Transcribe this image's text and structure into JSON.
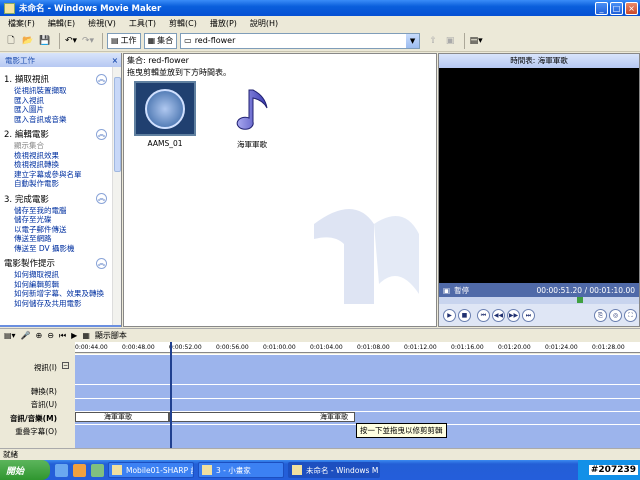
{
  "window": {
    "title": "未命名 - Windows Movie Maker"
  },
  "menu": [
    "檔案(F)",
    "編輯(E)",
    "檢視(V)",
    "工具(T)",
    "剪輯(C)",
    "播放(P)",
    "說明(H)"
  ],
  "toolbar": {
    "tasks_label": "工作",
    "collections_label": "集合",
    "collection_value": "red-flower"
  },
  "tasks_pane": {
    "header": "電影工作",
    "sections": [
      {
        "number": "1.",
        "title": "擷取視訊",
        "links": [
          "從視訊裝置擷取",
          "匯入視訊",
          "匯入圖片",
          "匯入音訊或音樂"
        ],
        "disabled": []
      },
      {
        "number": "2.",
        "title": "編輯電影",
        "links": [
          "顯示集合",
          "檢視視訊效果",
          "檢視視訊轉換",
          "建立字幕或參與名單",
          "自動製作電影"
        ],
        "disabled": [
          0
        ]
      },
      {
        "number": "3.",
        "title": "完成電影",
        "links": [
          "儲存至我的電腦",
          "儲存至光碟",
          "以電子郵件傳送",
          "傳送至網路",
          "傳送至 DV 攝影機"
        ],
        "disabled": []
      },
      {
        "number": "",
        "title": "電影製作提示",
        "links": [
          "如何擷取視訊",
          "如何編輯剪輯",
          "如何新增字幕、效果及轉換",
          "如何儲存及共用電影"
        ],
        "disabled": []
      }
    ]
  },
  "collection": {
    "title": "集合: red-flower",
    "subtitle": "拖曳剪輯並放到下方時間表。",
    "clips": [
      {
        "label": "AAMS_01",
        "icon": "video-thumbnail-icon"
      },
      {
        "label": "海軍軍歌",
        "icon": "music-note-icon"
      }
    ]
  },
  "preview": {
    "header": "時間表: 海軍軍歌",
    "status": "暫停",
    "time": "00:00:51.20 / 00:01:10.00",
    "seek_fraction": 0.71
  },
  "timeline": {
    "toggle_label": "顯示腳本",
    "ruler": [
      "0:00:44.00",
      "0:00:48.00",
      "0:00:52.00",
      "0:00:56.00",
      "0:01:00.00",
      "0:01:04.00",
      "0:01:08.00",
      "0:01:12.00",
      "0:01:16.00",
      "0:01:20.00",
      "0:01:24.00",
      "0:01:28.00"
    ],
    "tracks": [
      "視訊(I)",
      "轉換(R)",
      "音訊(U)",
      "音訊/音樂(M)",
      "重疊字幕(O)"
    ],
    "audio_clips": [
      "海軍軍歌",
      "海軍軍歌"
    ],
    "tooltip": "按一下並拖曳以修剪剪輯"
  },
  "statusbar": {
    "text": "就緒"
  },
  "taskbar": {
    "start": "開始",
    "tasks": [
      "Mobile01-SHARP 討...",
      "3 - 小畫家",
      "未命名 - Windows M..."
    ],
    "watermark": "#207239"
  },
  "colors": {
    "accent": "#0a5fdc",
    "timeline_track": "#9cb4ec",
    "preview_bg": "#000000"
  }
}
